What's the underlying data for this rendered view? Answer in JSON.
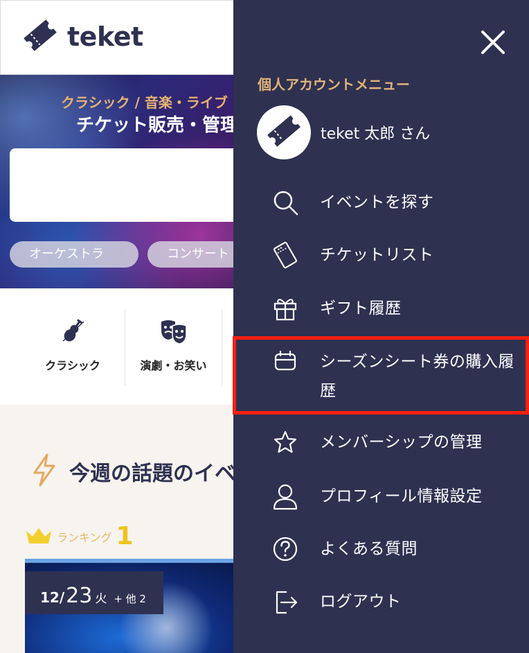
{
  "header": {
    "logo_text": "teket"
  },
  "hero": {
    "subtitle": "クラシック / 音楽・ライブ",
    "title": "チケット販売・管理",
    "chips": [
      "オーケストラ",
      "コンサート"
    ]
  },
  "categories": [
    {
      "label": "クラシック",
      "icon": "violin-icon"
    },
    {
      "label": "演劇・お笑い",
      "icon": "theater-masks-icon"
    }
  ],
  "weekly": {
    "title": "今週の話題のイベント",
    "icon": "lightning-icon"
  },
  "ranking": {
    "label": "ランキング",
    "number": "1"
  },
  "event_date": {
    "month_day": "12/",
    "day": "23",
    "weekday": "火",
    "more": "+ 他 2"
  },
  "drawer": {
    "heading": "個人アカウントメニュー",
    "user_name": "teket 太郎 さん",
    "items": [
      {
        "label": "イベントを探す",
        "icon": "search-icon"
      },
      {
        "label": "チケットリスト",
        "icon": "ticket-icon"
      },
      {
        "label": "ギフト履歴",
        "icon": "gift-icon"
      },
      {
        "label": "シーズンシート券の購入履歴",
        "icon": "calendar-icon"
      },
      {
        "label": "メンバーシップの管理",
        "icon": "star-icon"
      },
      {
        "label": "プロフィール情報設定",
        "icon": "person-icon"
      },
      {
        "label": "よくある質問",
        "icon": "question-icon"
      },
      {
        "label": "ログアウト",
        "icon": "logout-icon"
      }
    ]
  },
  "colors": {
    "drawer_bg": "#2e3150",
    "accent_gold": "#e3b47a",
    "highlight_red": "#ff1f0f",
    "ranking_yellow": "#f0c21e"
  }
}
